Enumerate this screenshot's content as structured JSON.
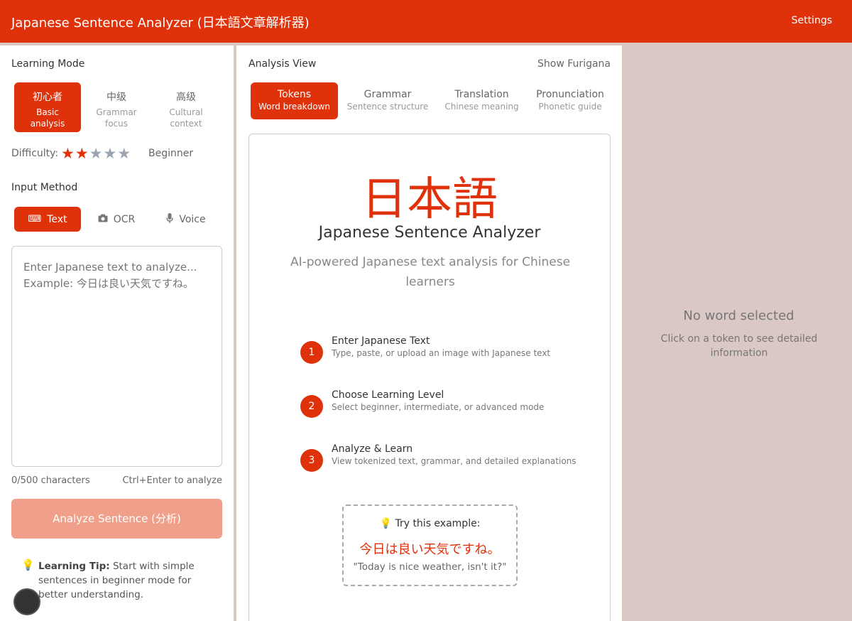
{
  "header": {
    "title": "Japanese Sentence Analyzer (日本語文章解析器)",
    "settings_label": "Settings"
  },
  "learning_mode": {
    "label": "Learning Mode",
    "modes": [
      {
        "title": "初心者",
        "subtitle": "Basic analysis",
        "active": true
      },
      {
        "title": "中级",
        "subtitle": "Grammar focus",
        "active": false
      },
      {
        "title": "高级",
        "subtitle": "Cultural context",
        "active": false
      }
    ],
    "difficulty_label": "Difficulty:",
    "difficulty_stars": 2,
    "difficulty_max": 5,
    "difficulty_level": "Beginner"
  },
  "input_method": {
    "label": "Input Method",
    "methods": [
      {
        "label": "Text",
        "icon": "keyboard-icon",
        "active": true
      },
      {
        "label": "OCR",
        "icon": "camera-icon",
        "active": false
      },
      {
        "label": "Voice",
        "icon": "microphone-icon",
        "active": false
      }
    ],
    "placeholder": "Enter Japanese text to analyze...\nExample: 今日は良い天気ですね。",
    "value": "",
    "char_count": "0/500 characters",
    "shortcut_hint": "Ctrl+Enter to analyze",
    "analyze_button": "Analyze Sentence (分析)",
    "tip_label": "Learning Tip:",
    "tip_text": "Start with simple sentences in beginner mode for better understanding."
  },
  "analysis": {
    "label": "Analysis View",
    "furigana_toggle": "Show Furigana",
    "tabs": [
      {
        "title": "Tokens",
        "subtitle": "Word breakdown",
        "active": true
      },
      {
        "title": "Grammar",
        "subtitle": "Sentence structure",
        "active": false
      },
      {
        "title": "Translation",
        "subtitle": "Chinese meaning",
        "active": false
      },
      {
        "title": "Pronunciation",
        "subtitle": "Phonetic guide",
        "active": false
      }
    ],
    "hero_jp": "日本語",
    "hero_title": "Japanese Sentence Analyzer",
    "hero_subtitle": "AI-powered Japanese text analysis for Chinese learners",
    "steps": [
      {
        "num": "1",
        "title": "Enter Japanese Text",
        "desc": "Type, paste, or upload an image with Japanese text"
      },
      {
        "num": "2",
        "title": "Choose Learning Level",
        "desc": "Select beginner, intermediate, or advanced mode"
      },
      {
        "num": "3",
        "title": "Analyze & Learn",
        "desc": "View tokenized text, grammar, and detailed explanations"
      }
    ],
    "example_heading": "Try this example:",
    "example_jp": "今日は良い天気ですね。",
    "example_en": "\"Today is nice weather, isn't it?\""
  },
  "details": {
    "empty_title": "No word selected",
    "empty_sub": "Click on a token to see detailed information"
  },
  "colors": {
    "accent": "#e0320a",
    "accent_disabled": "#f0a08a",
    "panel_bg": "#d9c8c3"
  }
}
